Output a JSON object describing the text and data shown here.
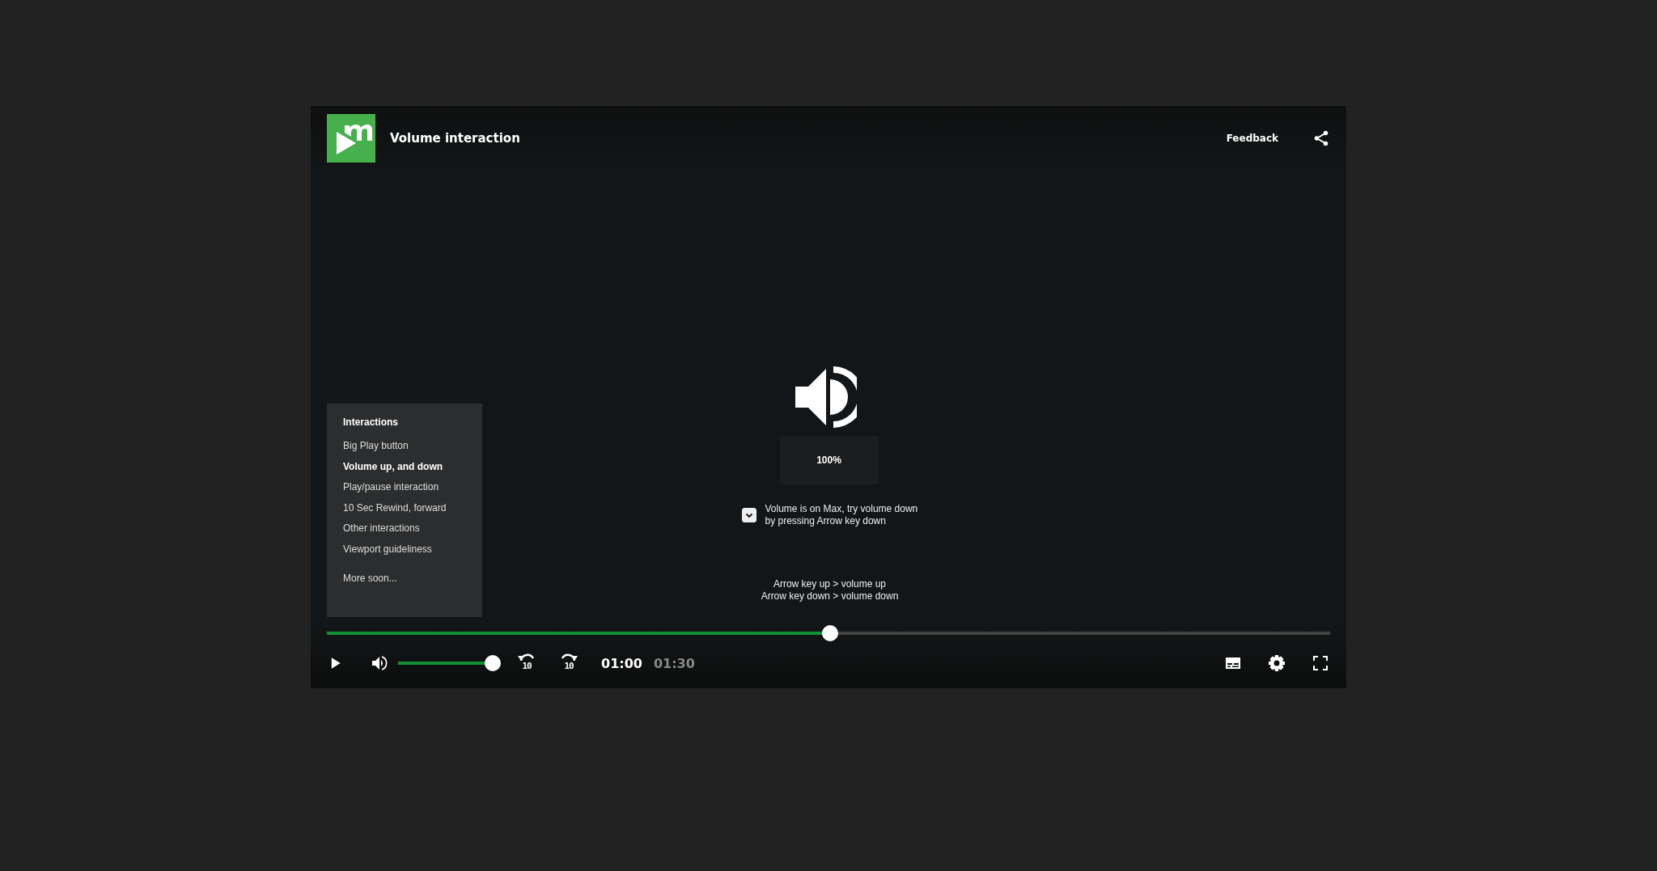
{
  "header": {
    "title": "Volume interaction",
    "feedback": "Feedback"
  },
  "menu": {
    "title": "Interactions",
    "items": [
      {
        "label": "Big Play button",
        "selected": false
      },
      {
        "label": "Volume up, and down",
        "selected": true
      },
      {
        "label": "Play/pause interaction",
        "selected": false
      },
      {
        "label": "10 Sec Rewind, forward",
        "selected": false
      },
      {
        "label": "Other interactions",
        "selected": false
      },
      {
        "label": "Viewport guideliness",
        "selected": false
      }
    ],
    "footer": "More soon..."
  },
  "volume_display": {
    "reading": "100%"
  },
  "hint": {
    "checked": true,
    "text": "Volume is on Max, try volume down by pressing Arrow key down"
  },
  "shortcuts": [
    "Arrow key up > volume up",
    "Arrow key down > volume down"
  ],
  "progress": {
    "level": 0.502
  },
  "controls": {
    "volume": {
      "level": 1
    },
    "rewind_label": "10",
    "forward_label": "10",
    "current_time": "01:00",
    "duration": "01:30"
  }
}
